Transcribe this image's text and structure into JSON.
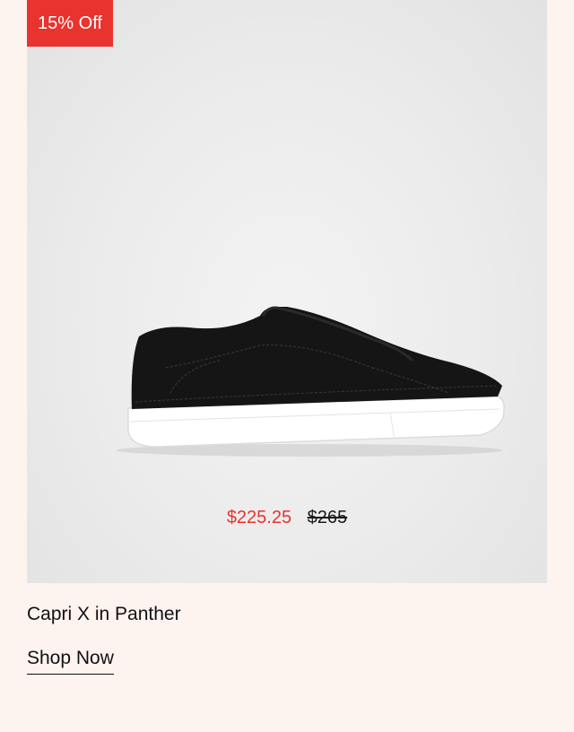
{
  "badge": {
    "label": "15% Off",
    "color": "#e8332e"
  },
  "product": {
    "image_icon": "sneaker-image",
    "name": "Capri X in Panther",
    "price_sale": "$225.25",
    "price_original": "$265",
    "sale_color": "#e8332e"
  },
  "cta": {
    "label": "Shop Now"
  }
}
